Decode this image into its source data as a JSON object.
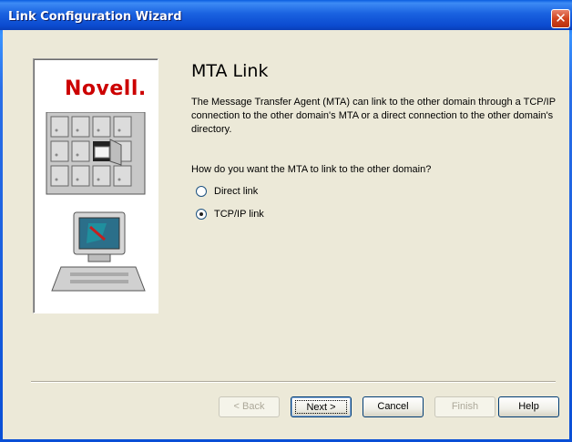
{
  "window": {
    "title": "Link Configuration Wizard",
    "close_glyph": "✕"
  },
  "side_panel": {
    "logo_text": "Novell",
    "logo_dot": ".",
    "illustration": "mailboxes-computer-icon"
  },
  "page": {
    "heading": "MTA Link",
    "description": "The Message Transfer Agent (MTA) can link to the other domain through a TCP/IP connection to the other domain's MTA or a direct connection to the other domain's directory.",
    "question": "How do you want the MTA to link to the other domain?",
    "options": [
      {
        "label": "Direct link",
        "checked": false
      },
      {
        "label": "TCP/IP link",
        "checked": true
      }
    ]
  },
  "buttons": {
    "back": "< Back",
    "next": "Next >",
    "cancel": "Cancel",
    "finish": "Finish",
    "help": "Help"
  },
  "colors": {
    "titlebar": "#0b4bd0",
    "logo_red": "#cc0000",
    "dialog_bg": "#ece9d8"
  }
}
